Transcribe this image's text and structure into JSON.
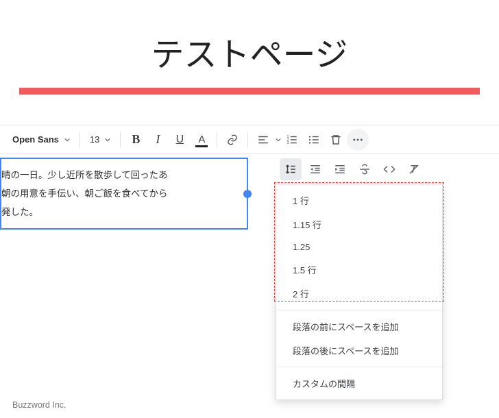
{
  "header": {
    "title": "テストページ"
  },
  "toolbar": {
    "font_name": "Open Sans",
    "font_size": "13",
    "bold": "B",
    "italic": "I",
    "underline": "U",
    "textcolor": "A"
  },
  "editor": {
    "line1": "晴の一日。少し近所を散歩して回ったあ",
    "line2": "朝の用意を手伝い、朝ご飯を食べてから",
    "line3": "発した。"
  },
  "line_spacing_menu": {
    "options": [
      "1 行",
      "1.15 行",
      "1.25",
      "1.5 行",
      "2 行"
    ],
    "add_before": "段落の前にスペースを追加",
    "add_after": "段落の後にスペースを追加",
    "custom": "カスタムの間隔"
  },
  "footer": {
    "credit": "Buzzword Inc."
  }
}
